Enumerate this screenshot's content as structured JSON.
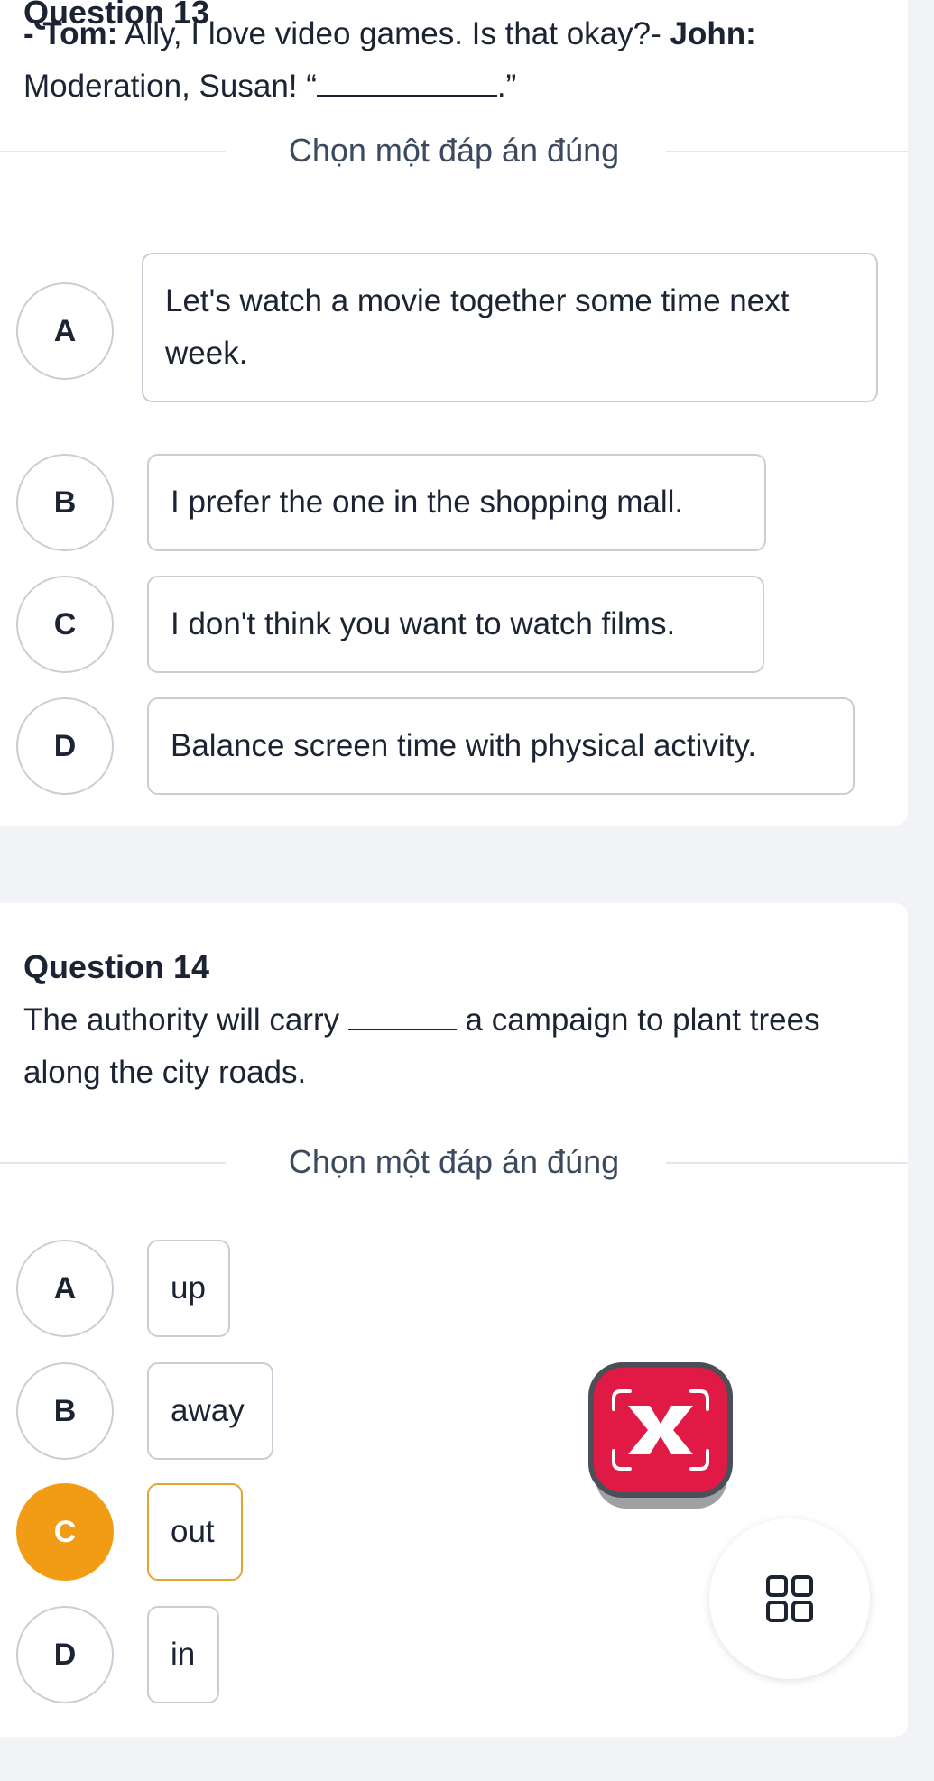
{
  "q13": {
    "title": "Question 13",
    "speaker1": "- Tom:",
    "line1": " Ally, I love video games. Is that okay?- ",
    "speaker2": "John:",
    "line2_start": "Moderation, Susan! “",
    "line2_end": ".”",
    "prompt": "Chọn một đáp án đúng",
    "options": [
      {
        "letter": "A",
        "text": "Let's watch a movie together some time next week."
      },
      {
        "letter": "B",
        "text": "I prefer the one in the shopping mall."
      },
      {
        "letter": "C",
        "text": "I don't think you want to watch films."
      },
      {
        "letter": "D",
        "text": "Balance screen time with physical activity."
      }
    ]
  },
  "q14": {
    "title": "Question 14",
    "text_start": "The authority will carry ",
    "text_end": " a campaign to plant trees along the city roads.",
    "prompt": "Chọn một đáp án đúng",
    "options": [
      {
        "letter": "A",
        "text": "up"
      },
      {
        "letter": "B",
        "text": "away"
      },
      {
        "letter": "C",
        "text": "out",
        "selected": true
      },
      {
        "letter": "D",
        "text": "in"
      }
    ]
  },
  "widgets": {
    "floating_x_icon": "close-x-icon",
    "menu_icon": "grid-menu-icon"
  },
  "colors": {
    "selected": "#f29c16",
    "floating_x": "#e01a45"
  }
}
